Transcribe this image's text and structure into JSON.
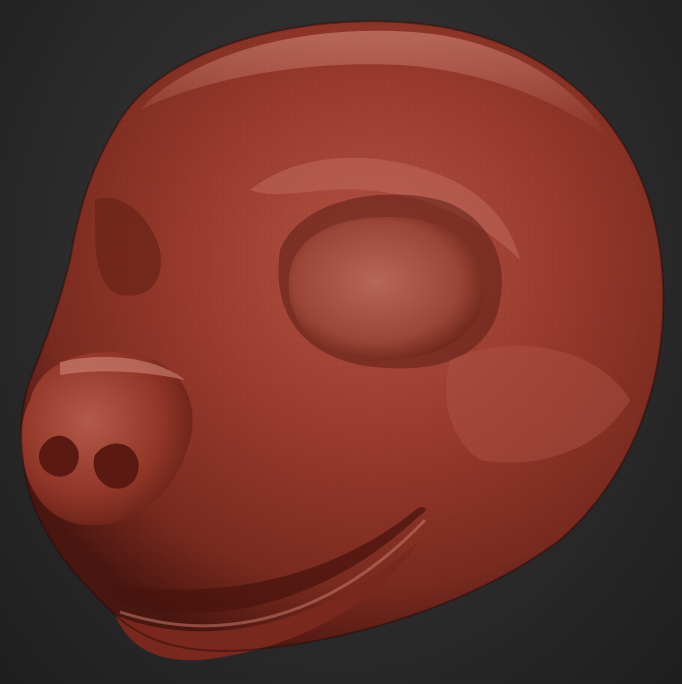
{
  "scene": {
    "subject": "sculpt-head-mesh",
    "material_color": "#9a3a2a",
    "highlight_color": "#c9756a",
    "shadow_color": "#4a1610",
    "background_color": "#2b2b2b"
  }
}
